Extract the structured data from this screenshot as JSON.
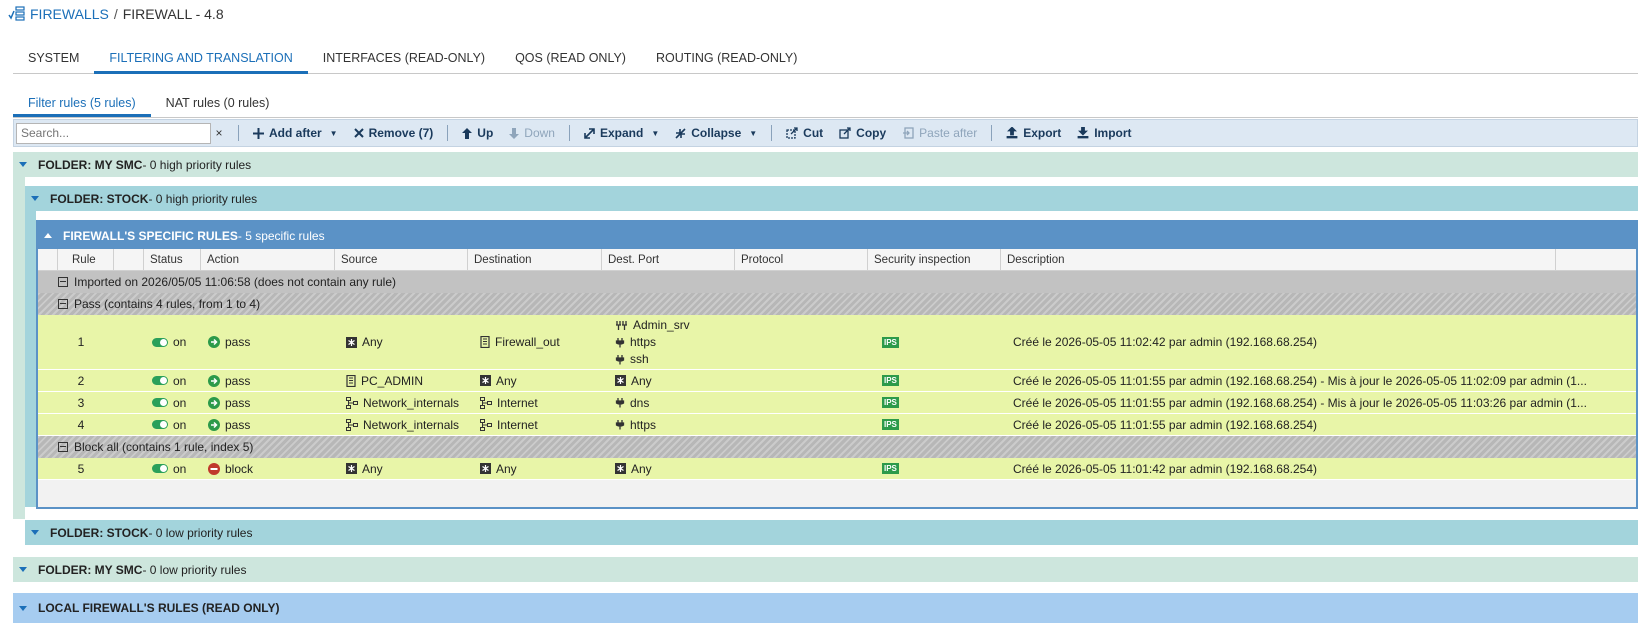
{
  "breadcrumb": {
    "root": "FIREWALLS",
    "separator": "/",
    "current": "FIREWALL - 4.8"
  },
  "main_tabs": [
    "SYSTEM",
    "FILTERING AND TRANSLATION",
    "INTERFACES (READ-ONLY)",
    "QOS (READ ONLY)",
    "ROUTING (READ-ONLY)"
  ],
  "sub_tabs": [
    "Filter rules (5 rules)",
    "NAT rules (0 rules)"
  ],
  "toolbar": {
    "search_placeholder": "Search...",
    "clear": "×",
    "add_after": "Add after",
    "remove": "Remove (7)",
    "up": "Up",
    "down": "Down",
    "expand": "Expand",
    "collapse": "Collapse",
    "cut": "Cut",
    "copy": "Copy",
    "paste_after": "Paste after",
    "export": "Export",
    "import": "Import"
  },
  "folders": {
    "mysmc_high": {
      "name": "FOLDER: MY SMC",
      "detail": " - 0 high priority rules"
    },
    "stock_high": {
      "name": "FOLDER: STOCK",
      "detail": " - 0 high priority rules"
    },
    "specific": {
      "name": "FIREWALL'S SPECIFIC RULES",
      "detail": " - 5 specific rules"
    },
    "stock_low": {
      "name": "FOLDER: STOCK",
      "detail": " - 0 low priority rules"
    },
    "mysmc_low": {
      "name": "FOLDER: MY SMC",
      "detail": " - 0 low priority rules"
    },
    "local": {
      "name": "LOCAL FIREWALL'S RULES (READ ONLY)"
    }
  },
  "columns": [
    "Rule",
    "Status",
    "Action",
    "Source",
    "Destination",
    "Dest. Port",
    "Protocol",
    "Security inspection",
    "Description"
  ],
  "separators": {
    "imported": "Imported on 2026/05/05 11:06:58 (does not contain any rule)",
    "pass": "Pass (contains 4 rules, from 1 to 4)",
    "block": "Block all (contains 1 rule, index 5)"
  },
  "rules": [
    {
      "num": "1",
      "status": "on",
      "action": "pass",
      "source": "Any",
      "destination": "Firewall_out",
      "ports": [
        "Admin_srv",
        "https",
        "ssh"
      ],
      "ips": "IPS",
      "description": "Créé le 2026-05-05 11:02:42 par admin (192.168.68.254)"
    },
    {
      "num": "2",
      "status": "on",
      "action": "pass",
      "source": "PC_ADMIN",
      "destination": "Any",
      "ports": [
        "Any"
      ],
      "ips": "IPS",
      "description": "Créé le 2026-05-05 11:01:55 par admin (192.168.68.254) - Mis à jour le 2026-05-05 11:02:09 par admin (1..."
    },
    {
      "num": "3",
      "status": "on",
      "action": "pass",
      "source": "Network_internals",
      "destination": "Internet",
      "ports": [
        "dns"
      ],
      "ips": "IPS",
      "description": "Créé le 2026-05-05 11:01:55 par admin (192.168.68.254) - Mis à jour le 2026-05-05 11:03:26 par admin (1..."
    },
    {
      "num": "4",
      "status": "on",
      "action": "pass",
      "source": "Network_internals",
      "destination": "Internet",
      "ports": [
        "https"
      ],
      "ips": "IPS",
      "description": "Créé le 2026-05-05 11:01:55 par admin (192.168.68.254)"
    },
    {
      "num": "5",
      "status": "on",
      "action": "block",
      "source": "Any",
      "destination": "Any",
      "ports": [
        "Any"
      ],
      "ips": "IPS",
      "description": "Créé le 2026-05-05 11:01:42 par admin (192.168.68.254)"
    }
  ],
  "colors": {
    "accent": "#1b6fb8",
    "rule_bg": "#e8f5a8",
    "specific_header": "#5b92c6",
    "ips": "#2c9a4a",
    "toggle_on": "#2aa05a",
    "block": "#c0392b"
  }
}
